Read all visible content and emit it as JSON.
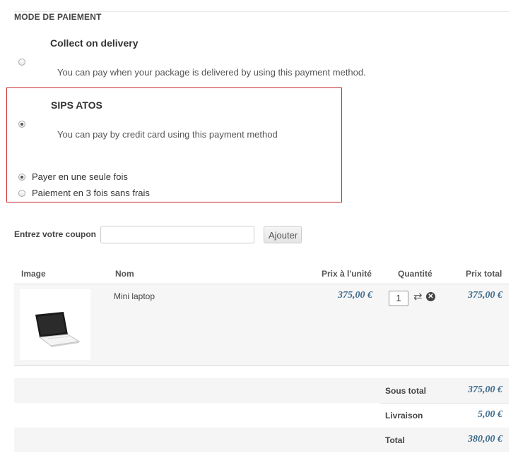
{
  "payment": {
    "section_title": "MODE DE PAIEMENT",
    "methods": [
      {
        "title": "Collect on delivery",
        "description": "You can pay when your package is delivered by using this payment method.",
        "selected": false
      },
      {
        "title": "SIPS ATOS",
        "description": "You can pay by credit card using this payment method",
        "selected": true
      }
    ],
    "sips_options": [
      {
        "label": "Payer en une seule fois",
        "selected": true
      },
      {
        "label": "Paiement en 3 fois sans frais",
        "selected": false
      }
    ],
    "highlight_color": "#c62828"
  },
  "coupon": {
    "label": "Entrez votre coupon",
    "value": "",
    "button_label": "Ajouter"
  },
  "cart": {
    "headers": [
      "Image",
      "Nom",
      "Prix à l'unité",
      "Quantité",
      "Prix total"
    ],
    "items": [
      {
        "name": "Mini laptop",
        "unit_price": "375,00 €",
        "quantity": "1",
        "total": "375,00 €",
        "image_icon": "laptop-image"
      }
    ]
  },
  "totals": {
    "subtotal_label": "Sous total",
    "subtotal": "375,00 €",
    "shipping_label": "Livraison",
    "shipping": "5,00 €",
    "total_label": "Total",
    "total": "380,00 €"
  },
  "colors": {
    "price": "#3d6a8a"
  }
}
